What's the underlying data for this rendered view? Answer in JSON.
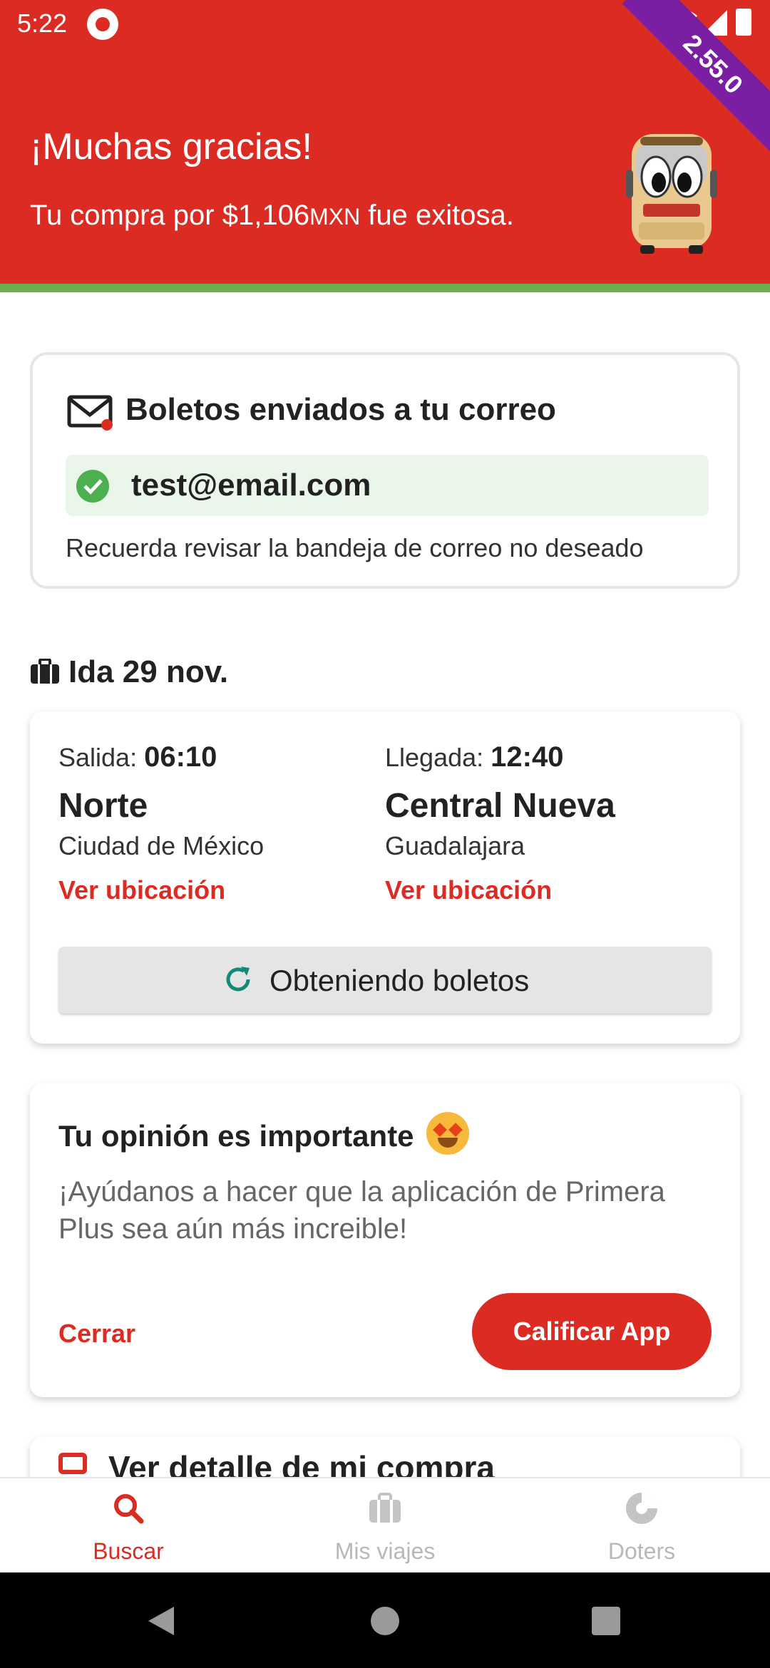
{
  "status_bar": {
    "time": "5:22"
  },
  "version_badge": "2.55.0",
  "header": {
    "title": "¡Muchas gracias!",
    "subtitle_prefix": "Tu compra por $1,106",
    "subtitle_currency": "MXN",
    "subtitle_suffix": " fue exitosa."
  },
  "email_card": {
    "title": "Boletos enviados a tu correo",
    "email": "test@email.com",
    "note": "Recuerda revisar la bandeja de correo no deseado",
    "icons": [
      "mail-icon",
      "check-circle-icon"
    ],
    "accent": "#dc2b22",
    "success_color": "#4caf50"
  },
  "trip_section": {
    "label": "Ida 29 nov.",
    "icon": "briefcase-icon"
  },
  "trip_card": {
    "departure": {
      "time_label": "Salida:",
      "time": "06:10",
      "station": "Norte",
      "city": "Ciudad de México",
      "location_link": "Ver ubicación"
    },
    "arrival": {
      "time_label": "Llegada:",
      "time": "12:40",
      "station": "Central Nueva",
      "city": "Guadalajara",
      "location_link": "Ver ubicación"
    },
    "status_button": "Obteniendo boletos"
  },
  "opinion_card": {
    "title": "Tu opinión es importante",
    "text": "¡Ayúdanos a hacer que la aplicación de Primera Plus sea aún más increible!",
    "close_label": "Cerrar",
    "rate_label": "Calificar App"
  },
  "detail_card": {
    "label": "Ver detalle de mi compra"
  },
  "bottom_nav": {
    "items": [
      {
        "label": "Buscar",
        "icon": "search-icon",
        "active": true
      },
      {
        "label": "Mis viajes",
        "icon": "briefcase-icon",
        "active": false
      },
      {
        "label": "Doters",
        "icon": "doters-icon",
        "active": false
      }
    ]
  },
  "colors": {
    "brand_red": "#dc2b22",
    "stripe_green": "#6ab04c",
    "ribbon_purple": "#7b1fa2",
    "refresh_teal": "#12897a"
  }
}
